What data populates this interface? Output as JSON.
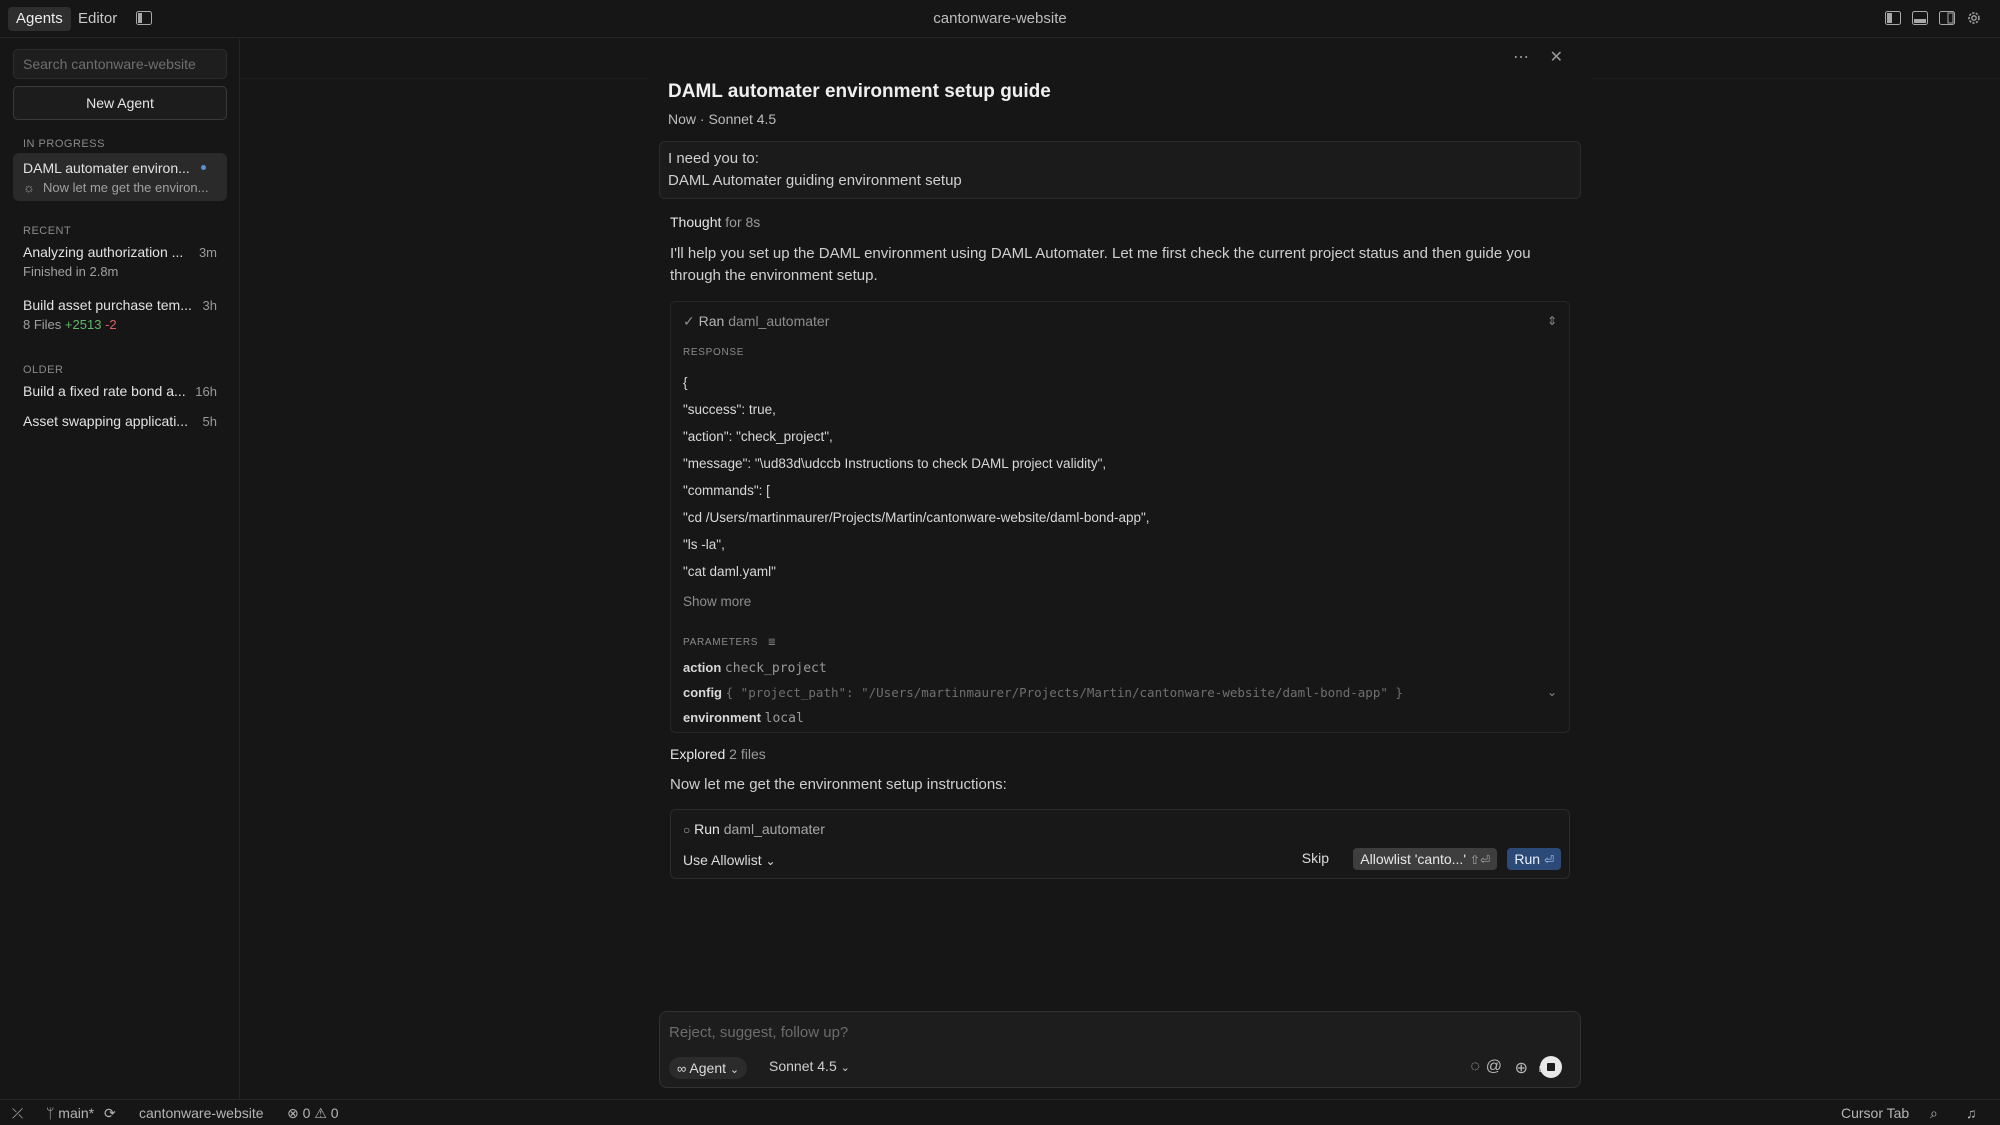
{
  "titlebar": {
    "tab_agents": "Agents",
    "tab_editor": "Editor",
    "window_title": "cantonware-website",
    "icons": [
      "sidebar-toggle-icon",
      "layout-left-icon",
      "layout-bottom-icon",
      "layout-right-icon",
      "gear-icon"
    ]
  },
  "sidebar": {
    "search_placeholder": "Search cantonware-website",
    "new_agent_label": "New Agent",
    "section_in_progress": "IN PROGRESS",
    "section_recent": "RECENT",
    "section_older": "OLDER",
    "in_progress": [
      {
        "title": "DAML automater environ...",
        "subtitle": "Now let me get the environ..."
      }
    ],
    "recent": [
      {
        "title": "Analyzing authorization ...",
        "time": "3m",
        "subtitle": "Finished in 2.8m"
      },
      {
        "title": "Build asset purchase tem...",
        "time": "3h",
        "files": "8 Files",
        "added": "+2513",
        "removed": "-2"
      }
    ],
    "older": [
      {
        "title": "Build a fixed rate bond a...",
        "time": "16h"
      },
      {
        "title": "Asset swapping applicati...",
        "time": "5h"
      }
    ]
  },
  "chat": {
    "title": "DAML automater environment setup guide",
    "meta_time": "Now",
    "meta_sep": "·",
    "meta_model": "Sonnet 4.5",
    "request_line1": "I need you to:",
    "request_line2": "DAML Automater guiding environment setup",
    "thought_label": "Thought",
    "thought_duration": "for 8s",
    "intro_text": "I'll help you set up the DAML environment using DAML Automater. Let me first check the current project status and then guide you through the environment setup.",
    "tool": {
      "status_prefix": "Ran",
      "tool_name": "daml_automater",
      "response_label": "RESPONSE",
      "response_lines": [
        "{",
        "\"success\": true,",
        "\"action\": \"check_project\",",
        "\"message\": \"\\ud83d\\udccb Instructions to check DAML project validity\",",
        "\"commands\": [",
        "\"cd /Users/martinmaurer/Projects/Martin/cantonware-website/daml-bond-app\",",
        "\"ls -la\",",
        "\"cat daml.yaml\""
      ],
      "show_more": "Show more",
      "parameters_label": "PARAMETERS",
      "params": [
        {
          "key": "action",
          "value": "check_project"
        },
        {
          "key": "config",
          "value": "{ \"project_path\": \"/Users/martinmaurer/Projects/Martin/cantonware-website/daml-bond-app\" }"
        },
        {
          "key": "environment",
          "value": "local"
        }
      ]
    },
    "explored_label": "Explored",
    "explored_count": "2 files",
    "followup_text": "Now let me get the environment setup instructions:",
    "pending": {
      "prefix": "Run",
      "tool_name": "daml_automater",
      "allowlist_dropdown": "Use Allowlist",
      "skip_label": "Skip",
      "allowlist_button": "Allowlist 'canto...'",
      "allowlist_shortcut": "⇧⏎",
      "run_label": "Run",
      "run_shortcut": "⏎"
    }
  },
  "composer": {
    "placeholder": "Reject, suggest, follow up?",
    "mode_label": "Agent",
    "model_label": "Sonnet 4.5"
  },
  "statusbar": {
    "branch": "main*",
    "project": "cantonware-website",
    "errors": "0",
    "warnings": "0",
    "cursor_tab": "Cursor Tab"
  }
}
